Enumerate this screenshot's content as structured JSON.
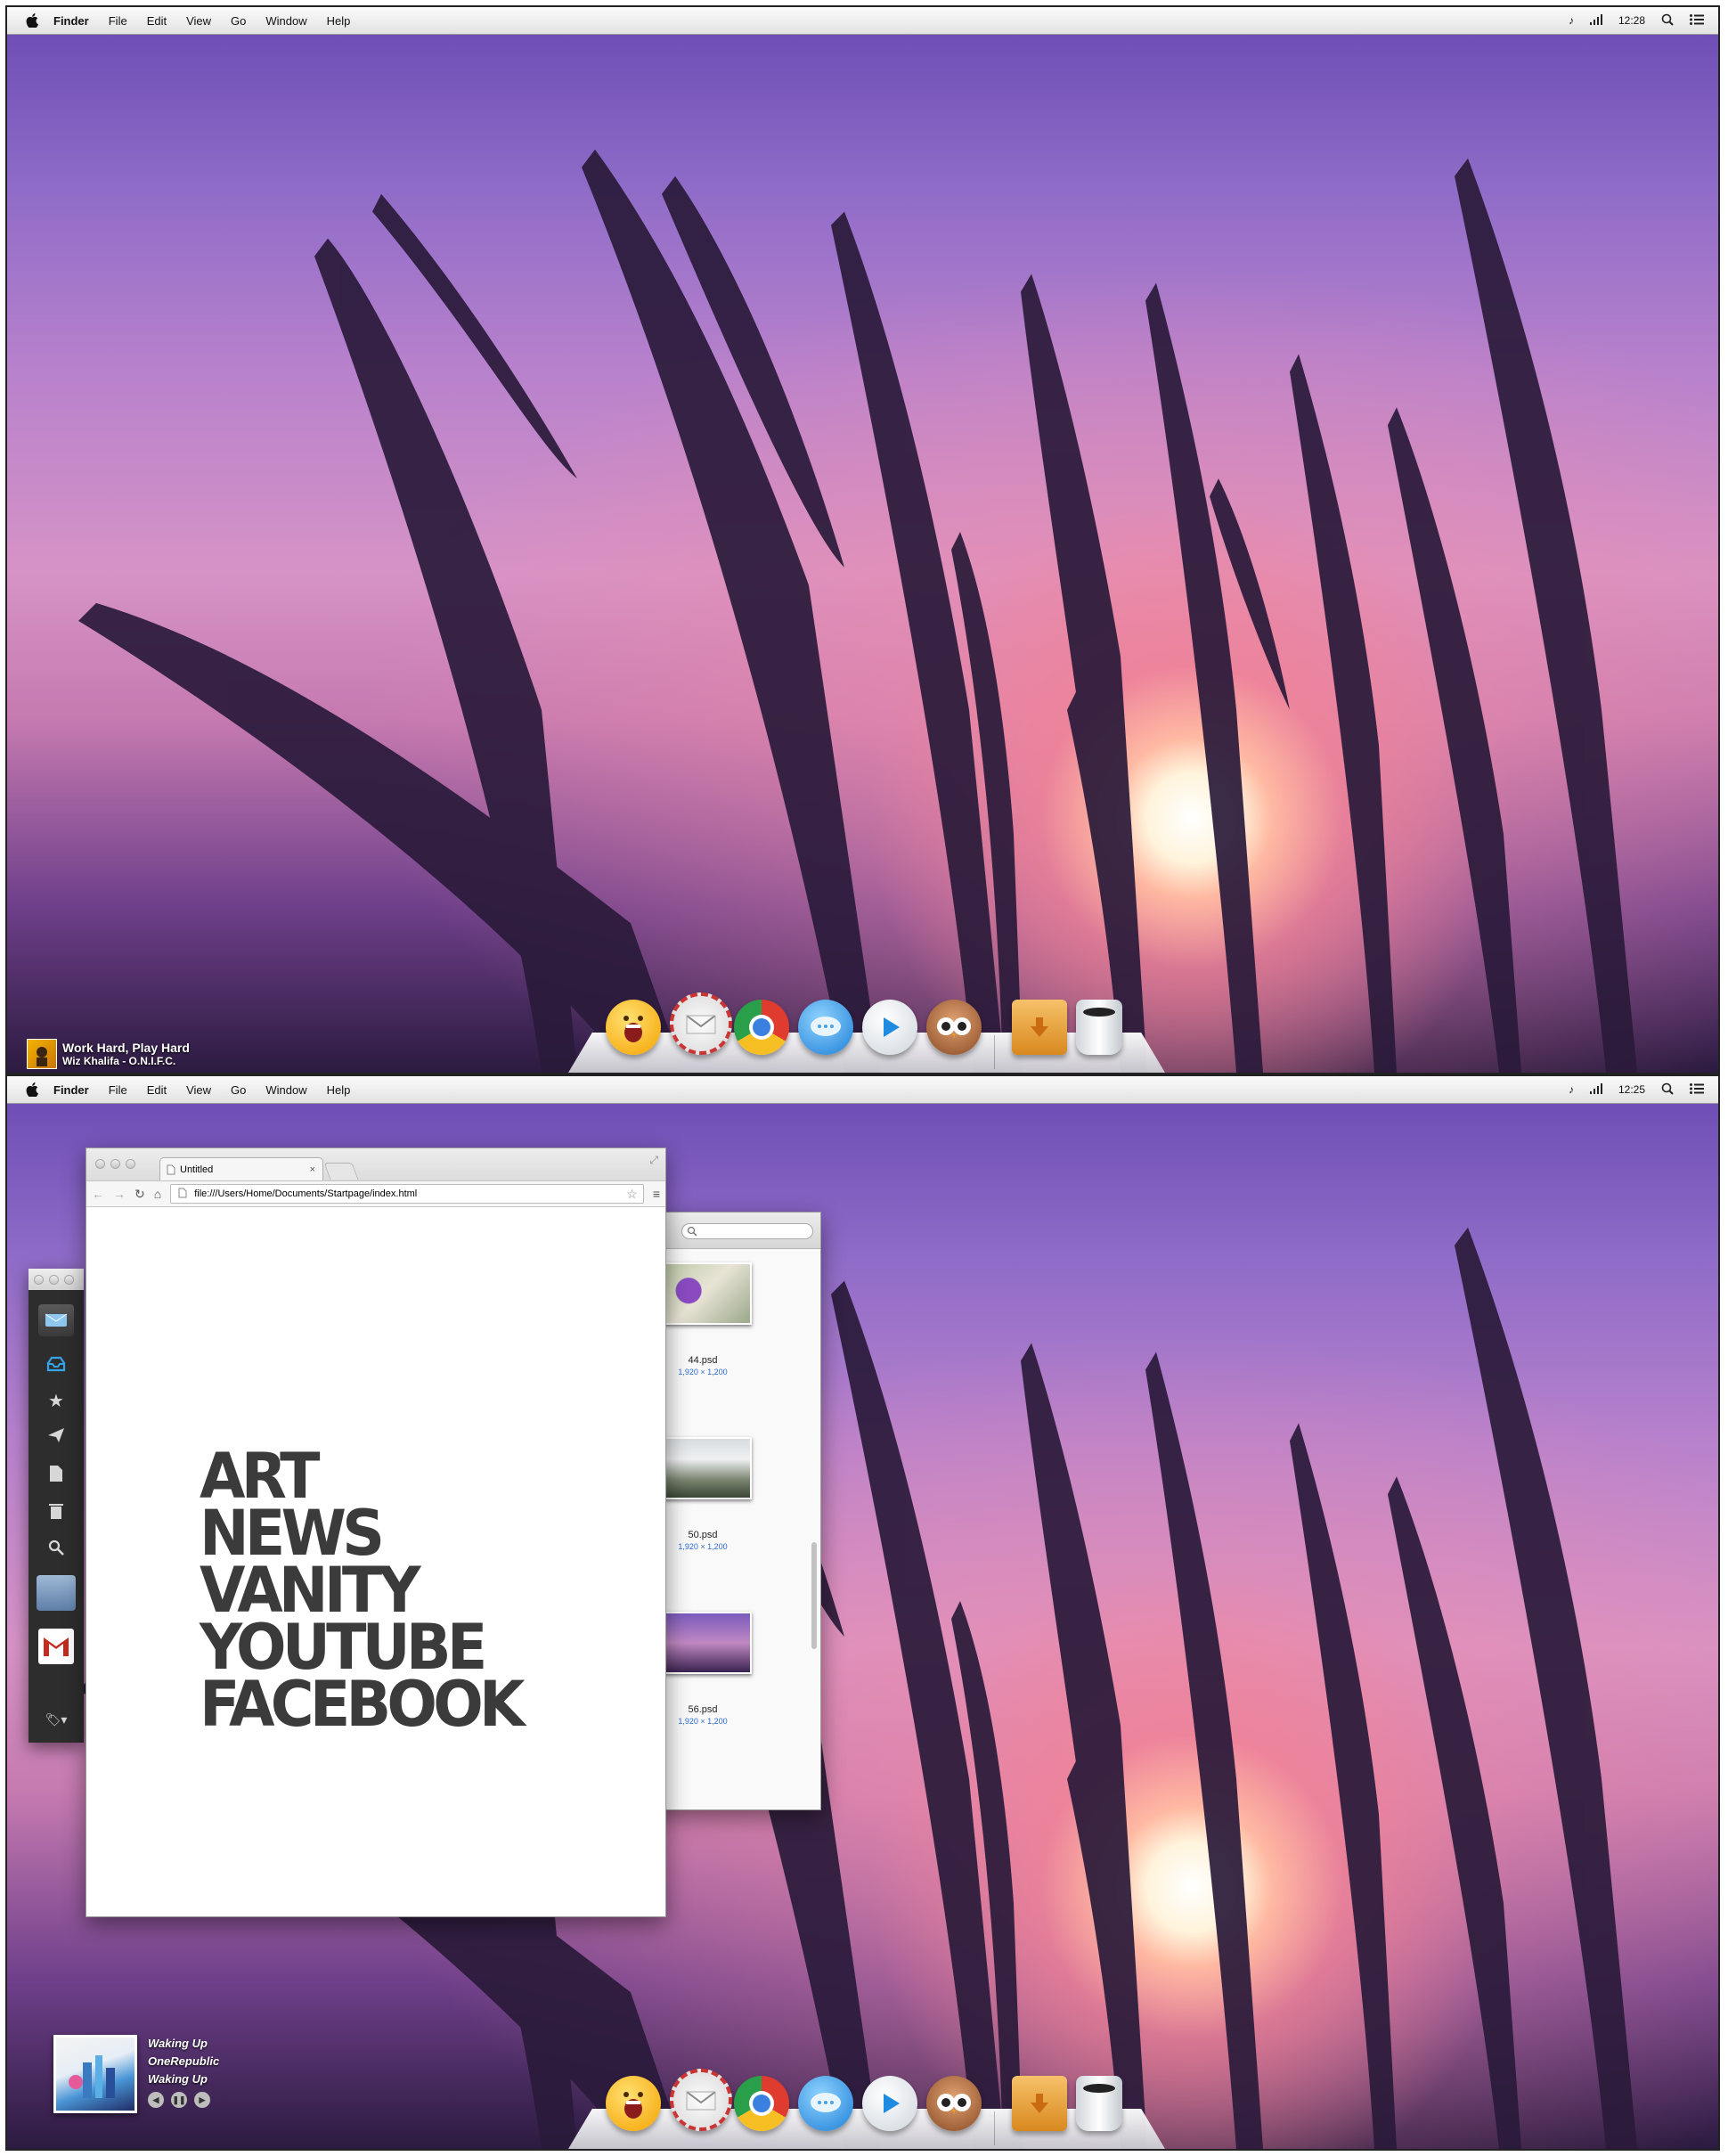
{
  "top_screen": {
    "menubar": {
      "app_name": "Finder",
      "items": [
        "File",
        "Edit",
        "View",
        "Go",
        "Window",
        "Help"
      ],
      "clock": "12:28"
    },
    "now_playing": {
      "title": "Work Hard, Play Hard",
      "artist_album": "Wiz Khalifa - O.N.I.F.C."
    }
  },
  "bottom_screen": {
    "menubar": {
      "app_name": "Finder",
      "items": [
        "File",
        "Edit",
        "View",
        "Go",
        "Window",
        "Help"
      ],
      "clock": "12:25"
    },
    "browser": {
      "tab_title": "Untitled",
      "url": "file:///Users/Home/Documents/Startpage/index.html",
      "startpage_links": [
        "ART",
        "NEWS",
        "VANITY",
        "YOUTUBE",
        "FACEBOOK"
      ]
    },
    "finder_files": [
      {
        "name": "44.psd",
        "dimensions": "1,920 × 1,200"
      },
      {
        "name": "50.psd",
        "dimensions": "1,920 × 1,200"
      },
      {
        "name": "56.psd",
        "dimensions": "1,920 × 1,200"
      }
    ],
    "now_playing": {
      "track": "Waking Up",
      "artist": "OneRepublic",
      "album": "Waking Up"
    }
  },
  "dock": [
    "yelling-smiley-icon",
    "mail-stamp-icon",
    "chrome-icon",
    "messages-icon",
    "quicktime-play-icon",
    "owl-icon",
    "downloads-box-icon",
    "trash-can-icon"
  ],
  "colors": {
    "accent_blue": "#2d6bd6",
    "startpage_text": "#3b3b3b"
  }
}
